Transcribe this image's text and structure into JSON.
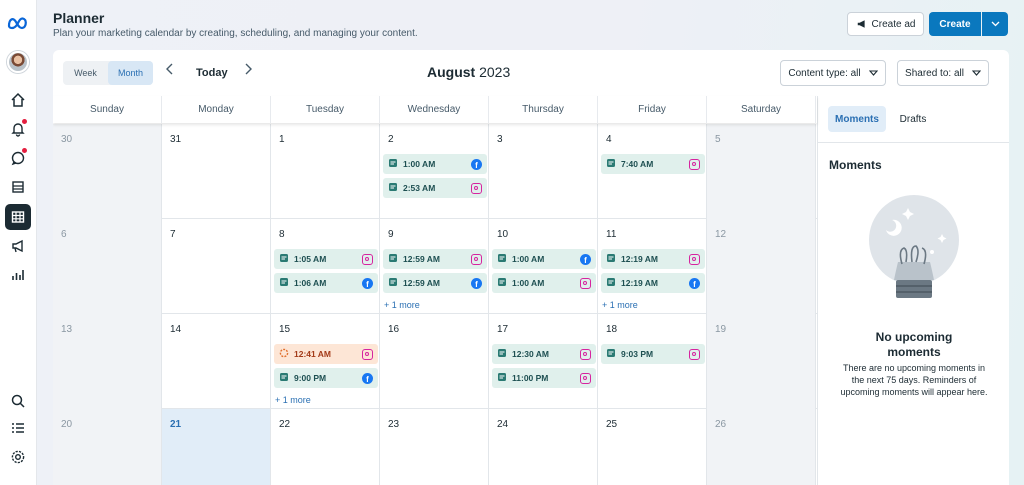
{
  "header": {
    "title": "Planner",
    "subtitle": "Plan your marketing calendar by creating, scheduling, and managing your content.",
    "create_ad_label": "Create ad",
    "create_label": "Create"
  },
  "toolbar": {
    "view_week": "Week",
    "view_month": "Month",
    "today": "Today",
    "month_name": "August",
    "year": "2023",
    "content_type_filter": "Content type: all",
    "shared_to_filter": "Shared to: all"
  },
  "weekdays": [
    "Sunday",
    "Monday",
    "Tuesday",
    "Wednesday",
    "Thursday",
    "Friday",
    "Saturday"
  ],
  "weeks": [
    [
      {
        "day": "30",
        "state": "other-month",
        "events": []
      },
      {
        "day": "31",
        "state": "normal",
        "events": []
      },
      {
        "day": "1",
        "state": "normal",
        "events": []
      },
      {
        "day": "2",
        "state": "normal",
        "events": [
          {
            "time": "1:00 AM",
            "platform": "facebook",
            "status": "scheduled"
          },
          {
            "time": "2:53 AM",
            "platform": "instagram",
            "status": "scheduled"
          }
        ]
      },
      {
        "day": "3",
        "state": "normal",
        "events": []
      },
      {
        "day": "4",
        "state": "normal",
        "events": [
          {
            "time": "7:40 AM",
            "platform": "instagram",
            "status": "scheduled"
          }
        ]
      },
      {
        "day": "5",
        "state": "weekend",
        "events": []
      }
    ],
    [
      {
        "day": "6",
        "state": "weekend",
        "events": []
      },
      {
        "day": "7",
        "state": "normal",
        "events": []
      },
      {
        "day": "8",
        "state": "normal",
        "events": [
          {
            "time": "1:05 AM",
            "platform": "instagram",
            "status": "scheduled"
          },
          {
            "time": "1:06 AM",
            "platform": "facebook",
            "status": "scheduled"
          }
        ]
      },
      {
        "day": "9",
        "state": "normal",
        "more": "+ 1 more",
        "events": [
          {
            "time": "12:59 AM",
            "platform": "instagram",
            "status": "scheduled"
          },
          {
            "time": "12:59 AM",
            "platform": "facebook",
            "status": "scheduled"
          }
        ]
      },
      {
        "day": "10",
        "state": "normal",
        "events": [
          {
            "time": "1:00 AM",
            "platform": "facebook",
            "status": "scheduled"
          },
          {
            "time": "1:00 AM",
            "platform": "instagram",
            "status": "scheduled"
          }
        ]
      },
      {
        "day": "11",
        "state": "normal",
        "more": "+ 1 more",
        "events": [
          {
            "time": "12:19 AM",
            "platform": "instagram",
            "status": "scheduled"
          },
          {
            "time": "12:19 AM",
            "platform": "facebook",
            "status": "scheduled"
          }
        ]
      },
      {
        "day": "12",
        "state": "weekend",
        "events": []
      }
    ],
    [
      {
        "day": "13",
        "state": "weekend",
        "events": []
      },
      {
        "day": "14",
        "state": "normal",
        "events": []
      },
      {
        "day": "15",
        "state": "normal",
        "more": "+ 1 more",
        "events": [
          {
            "time": "12:41 AM",
            "platform": "instagram",
            "status": "pending"
          },
          {
            "time": "9:00 PM",
            "platform": "facebook",
            "status": "scheduled"
          }
        ]
      },
      {
        "day": "16",
        "state": "normal",
        "events": []
      },
      {
        "day": "17",
        "state": "normal",
        "events": [
          {
            "time": "12:30 AM",
            "platform": "instagram",
            "status": "scheduled"
          },
          {
            "time": "11:00 PM",
            "platform": "instagram",
            "status": "scheduled"
          }
        ]
      },
      {
        "day": "18",
        "state": "normal",
        "events": [
          {
            "time": "9:03 PM",
            "platform": "instagram",
            "status": "scheduled"
          }
        ]
      },
      {
        "day": "19",
        "state": "weekend",
        "events": []
      }
    ],
    [
      {
        "day": "20",
        "state": "weekend",
        "events": []
      },
      {
        "day": "21",
        "state": "today",
        "events": []
      },
      {
        "day": "22",
        "state": "normal",
        "events": []
      },
      {
        "day": "23",
        "state": "normal",
        "events": []
      },
      {
        "day": "24",
        "state": "normal",
        "events": []
      },
      {
        "day": "25",
        "state": "normal",
        "events": []
      },
      {
        "day": "26",
        "state": "weekend",
        "events": []
      }
    ]
  ],
  "right_panel": {
    "tab_moments": "Moments",
    "tab_drafts": "Drafts",
    "heading": "Moments",
    "empty_title": "No upcoming moments",
    "empty_desc": "There are no upcoming moments in the next 75 days. Reminders of upcoming moments will appear here."
  },
  "nav_icons": [
    "meta-logo-icon",
    "avatar",
    "home-icon",
    "notifications-icon",
    "inbox-icon",
    "content-icon",
    "planner-icon",
    "ads-icon",
    "insights-icon",
    "search-icon",
    "all-tools-icon",
    "settings-icon"
  ],
  "colors": {
    "accent": "#0a78be",
    "scheduled_bg": "#e0f0ec",
    "pending_bg": "#fde6d6",
    "today_bg": "#e1edf8"
  }
}
